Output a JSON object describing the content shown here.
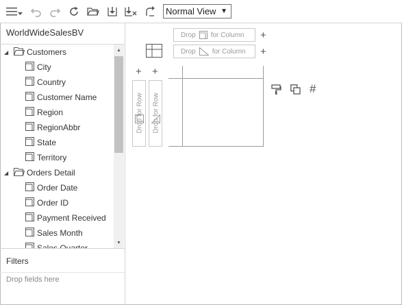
{
  "toolbar": {
    "icons": [
      "menu-icon",
      "undo-icon",
      "redo-icon",
      "refresh-icon",
      "open-folder-icon",
      "save-icon",
      "save-as-icon",
      "export-icon"
    ],
    "view_select": {
      "value": "Normal View",
      "arrow": "▼"
    }
  },
  "left_panel": {
    "title": "WorldWideSalesBV",
    "tree": {
      "folders": [
        {
          "label": "Customers",
          "fields": [
            "City",
            "Country",
            "Customer Name",
            "Region",
            "RegionAbbr",
            "State",
            "Territory"
          ]
        },
        {
          "label": "Orders Detail",
          "fields": [
            "Order Date",
            "Order ID",
            "Payment Received",
            "Sales Month",
            "Sales Quarter"
          ]
        }
      ]
    },
    "filters": {
      "title": "Filters",
      "hint": "Drop fields here"
    }
  },
  "canvas": {
    "column_drop_1": {
      "drop": "Drop",
      "target": "for Column"
    },
    "column_drop_2": {
      "drop": "Drop",
      "target": "for Column"
    },
    "row_drop_1": {
      "text": "Drop   for Row"
    },
    "row_drop_2": {
      "text": "Drop   for Row"
    },
    "plus": "+",
    "format_icons": [
      "paint-brush-icon",
      "copy-icon",
      "hash-icon"
    ],
    "hash_symbol": "#"
  },
  "colors": {
    "border": "#d3d3d3",
    "scroll_thumb": "#c2c2c2",
    "muted_text": "#9a9a9a"
  }
}
